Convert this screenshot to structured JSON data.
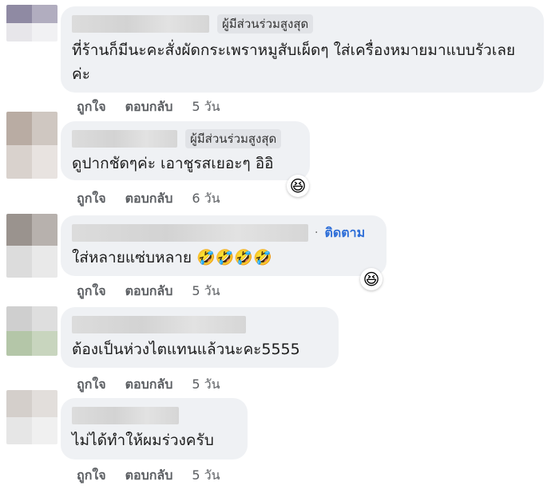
{
  "comments": [
    {
      "badge": "ผู้มีส่วนร่วมสูงสุด",
      "follow": "",
      "text": "ที่ร้านก็มีนะคะสั่งผัดกระเพราหมูสับเผ็ดๆ ใส่เครื่องหมายมาแบบรัวเลยค่ะ",
      "like": "ถูกใจ",
      "reply": "ตอบกลับ",
      "time": "5 วัน",
      "reaction": ""
    },
    {
      "badge": "ผู้มีส่วนร่วมสูงสุด",
      "follow": "",
      "text": "ดูปากชัดๆค่ะ เอาชูรสเยอะๆ อิอิ",
      "like": "ถูกใจ",
      "reply": "ตอบกลับ",
      "time": "6 วัน",
      "reaction": "😆"
    },
    {
      "badge": "",
      "follow": "ติดตาม",
      "text": "ใส่หลายแซ่บหลาย 🤣🤣🤣🤣",
      "like": "ถูกใจ",
      "reply": "ตอบกลับ",
      "time": "5 วัน",
      "reaction": "😆"
    },
    {
      "badge": "",
      "follow": "",
      "text": "ต้องเป็นห่วงไตแทนแล้วนะคะ5555",
      "like": "ถูกใจ",
      "reply": "ตอบกลับ",
      "time": "5 วัน",
      "reaction": ""
    },
    {
      "badge": "",
      "follow": "",
      "text": "ไม่ได้ทำให้ผมร่วงครับ",
      "like": "ถูกใจ",
      "reply": "ตอบกลับ",
      "time": "5 วัน",
      "reaction": ""
    }
  ],
  "colors": {
    "bubble": "#eff1f4",
    "badge": "#e1e3e7",
    "link": "#2f6fd8",
    "meta": "#5b5e62"
  }
}
